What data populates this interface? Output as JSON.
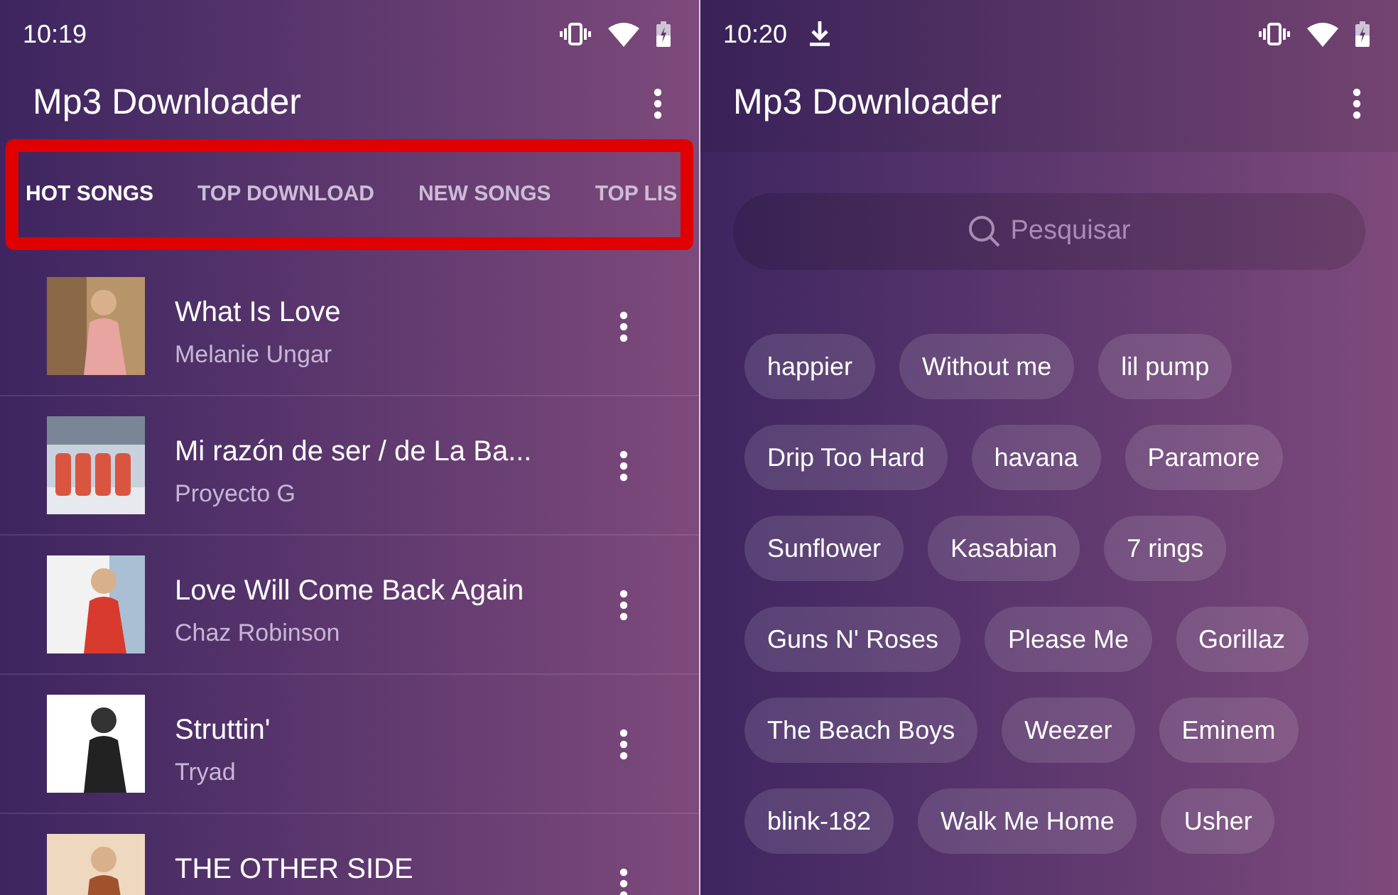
{
  "left_screen": {
    "status_bar": {
      "time": "10:19"
    },
    "toolbar": {
      "title": "Mp3 Downloader"
    },
    "tabs": [
      {
        "label": "HOT SONGS",
        "selected": true
      },
      {
        "label": "TOP DOWNLOAD",
        "selected": false
      },
      {
        "label": "NEW SONGS",
        "selected": false
      },
      {
        "label": "TOP LIS",
        "selected": false
      }
    ],
    "songs": [
      {
        "title": "What Is Love",
        "artist": "Melanie Ungar"
      },
      {
        "title": "Mi razón de ser / de La Ba...",
        "artist": "Proyecto G"
      },
      {
        "title": "Love Will Come Back Again",
        "artist": "Chaz Robinson"
      },
      {
        "title": "Struttin'",
        "artist": "Tryad"
      },
      {
        "title": "THE OTHER SIDE"
      }
    ]
  },
  "right_screen": {
    "status_bar": {
      "time": "10:20"
    },
    "toolbar": {
      "title": "Mp3 Downloader"
    },
    "search": {
      "placeholder": "Pesquisar"
    },
    "chip_rows": [
      [
        "happier",
        "Without me",
        "lil pump"
      ],
      [
        "Drip Too Hard",
        "havana",
        "Paramore"
      ],
      [
        "Sunflower",
        "Kasabian",
        "7 rings"
      ],
      [
        "Guns N' Roses",
        "Please Me",
        "Gorillaz"
      ],
      [
        "The Beach Boys",
        "Weezer",
        "Eminem"
      ],
      [
        "blink-182",
        "Walk Me Home",
        "Usher"
      ]
    ]
  }
}
